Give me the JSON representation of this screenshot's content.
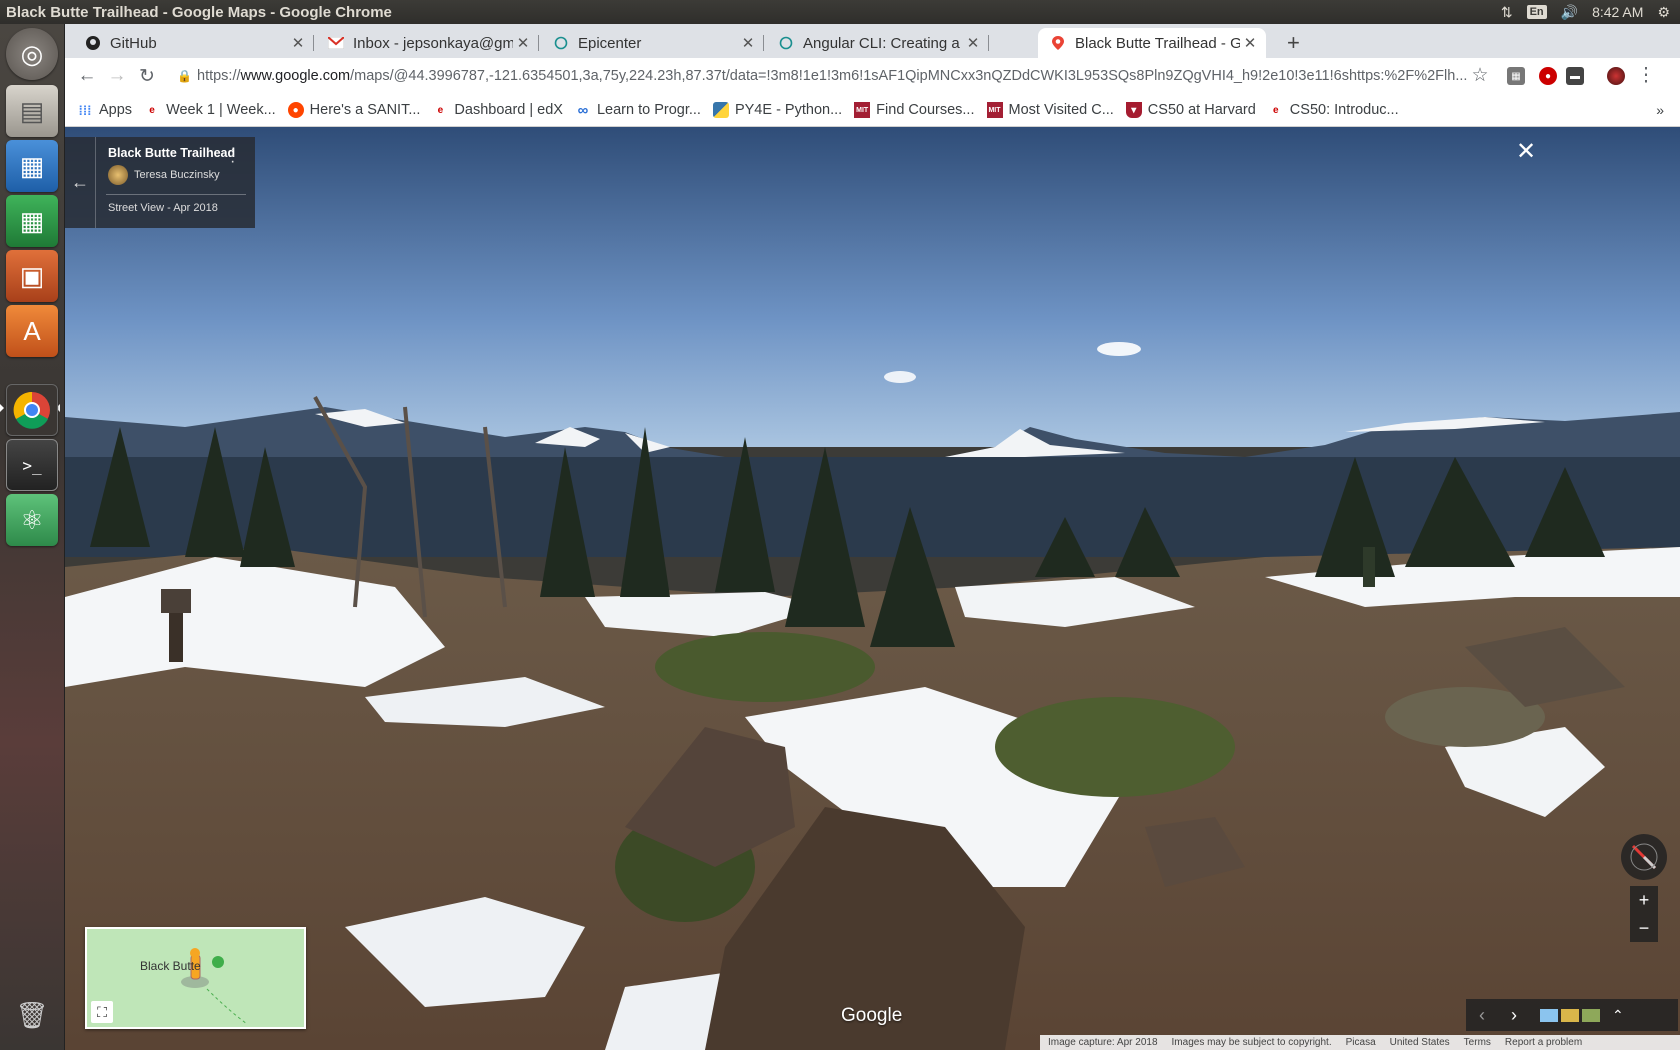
{
  "window": {
    "title": "Black Butte Trailhead - Google Maps - Google Chrome"
  },
  "system": {
    "keyboard": "En",
    "time": "8:42 AM"
  },
  "launcher": {
    "items": [
      "dash-home",
      "files",
      "writer",
      "calc",
      "impress",
      "software-center",
      "chrome",
      "terminal",
      "atom",
      "trash"
    ]
  },
  "tabs": [
    {
      "title": "GitHub",
      "icon": "github-icon"
    },
    {
      "title": "Inbox - jepsonkaya@gmail.com",
      "icon": "gmail-icon"
    },
    {
      "title": "Epicenter",
      "icon": "loading-icon"
    },
    {
      "title": "Angular CLI: Creating a Project",
      "icon": "loading-icon"
    },
    {
      "title": "Black Butte Trailhead - Google Maps",
      "icon": "maps-icon"
    }
  ],
  "omnibox": {
    "scheme": "https://",
    "host": "www.google.com",
    "path": "/maps/@44.3996787,-121.6354501,3a,75y,224.23h,87.37t/data=!3m8!1e1!3m6!1sAF1QipMNCxx3nQZDdCWKI3L953SQs8Pln9ZQgVHI4_h9!2e10!3e11!6shttps:%2F%2Flh..."
  },
  "bookmarks": [
    {
      "label": "Apps",
      "icon": "apps-icon"
    },
    {
      "label": "Week 1 | Week...",
      "icon": "edx-icon"
    },
    {
      "label": "Here's a SANIT...",
      "icon": "reddit-icon"
    },
    {
      "label": "Dashboard | edX",
      "icon": "edx-icon"
    },
    {
      "label": "Learn to Progr...",
      "icon": "infinity-icon"
    },
    {
      "label": "PY4E - Python...",
      "icon": "python-icon"
    },
    {
      "label": "Find Courses...",
      "icon": "mit-icon"
    },
    {
      "label": "Most Visited C...",
      "icon": "mit-icon"
    },
    {
      "label": "CS50 at Harvard",
      "icon": "harvard-icon"
    },
    {
      "label": "CS50: Introduc...",
      "icon": "edx-icon"
    }
  ],
  "streetview": {
    "place": "Black Butte Trailhead",
    "author": "Teresa Buczinsky",
    "date": "Street View - Apr 2018",
    "minimap_label": "Black Butte",
    "logo": "Google",
    "footer": [
      "Image capture: Apr 2018",
      "Images may be subject to copyright.",
      "Picasa",
      "United States",
      "Terms",
      "Report a problem"
    ]
  },
  "colors": {
    "tab_active": "#ffffff",
    "tab_strip": "#dee1e6",
    "sky_top": "#2f4d78",
    "sky_bottom": "#8fb3d6"
  }
}
